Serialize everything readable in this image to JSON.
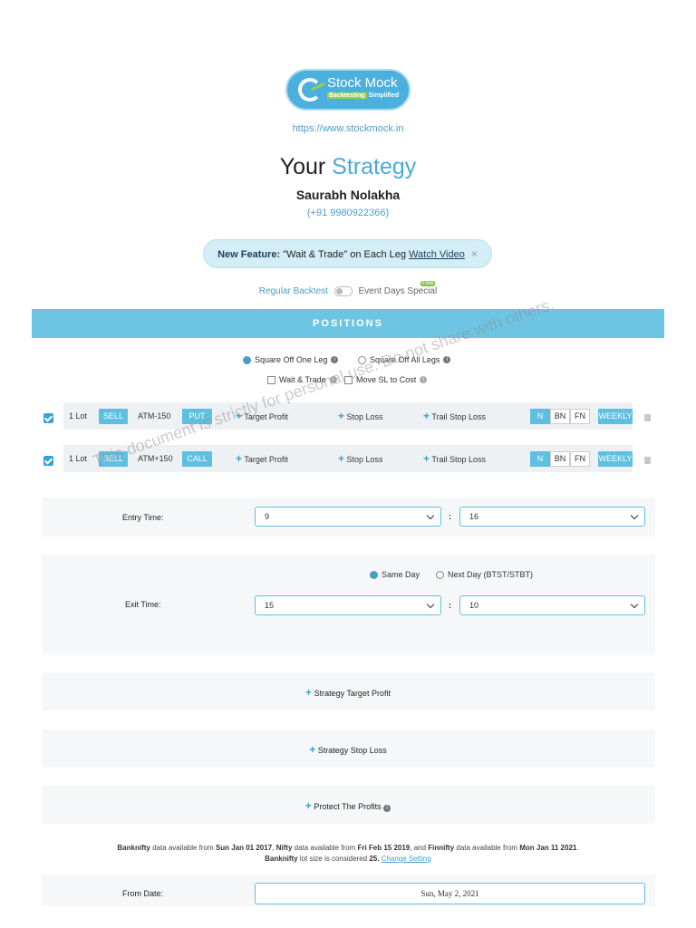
{
  "logo": {
    "name": "Stock Mock",
    "tagline_a": "Backtesting",
    "tagline_b": "Simplified"
  },
  "site_url": "https://www.stockmock.in",
  "title": {
    "part1": "Your",
    "part2": "Strategy"
  },
  "user": {
    "name": "Saurabh Nolakha",
    "phone": "(+91 9980922366)"
  },
  "banner": {
    "label": "New Feature:",
    "text": "\"Wait & Trade\" on Each Leg",
    "link": "Watch Video",
    "close": "×"
  },
  "mode": {
    "left": "Regular Backtest",
    "right": "Event Days Special",
    "badge": "Free"
  },
  "positions_title": "POSITIONS",
  "square_off": {
    "one_leg": "Square Off One Leg",
    "all_legs": "Square Off All Legs",
    "selected": "one_leg"
  },
  "options": {
    "wait_trade": "Wait & Trade",
    "move_sl": "Move SL to Cost"
  },
  "legs": [
    {
      "lots": "1 Lot",
      "side": "SELL",
      "strike": "ATM-150",
      "type": "PUT",
      "target": "Target Profit",
      "stop": "Stop Loss",
      "trail": "Trail Stop Loss",
      "indices": [
        "N",
        "BN",
        "FN"
      ],
      "selected_index": "BN",
      "expiry": "WEEKLY"
    },
    {
      "lots": "1 Lot",
      "side": "SELL",
      "strike": "ATM+150",
      "type": "CALL",
      "target": "Target Profit",
      "stop": "Stop Loss",
      "trail": "Trail Stop Loss",
      "indices": [
        "N",
        "BN",
        "FN"
      ],
      "selected_index": "BN",
      "expiry": "WEEKLY"
    }
  ],
  "entry": {
    "label": "Entry Time:",
    "hour": "9",
    "sep": ":",
    "minute": "16"
  },
  "exit": {
    "label": "Exit Time:",
    "same_day": "Same Day",
    "next_day": "Next Day (BTST/STBT)",
    "hour": "15",
    "sep": ":",
    "minute": "10"
  },
  "strategy_target": "Strategy Target Profit",
  "strategy_stop": "Strategy Stop Loss",
  "protect_profits": "Protect The Profits",
  "notice": {
    "bn": "Banknifty",
    "t1": " data available from ",
    "bn_date": "Sun Jan 01 2017",
    "t2": ", ",
    "nf": "Nifty",
    "t3": " data available from ",
    "nf_date": "Fri Feb 15 2019",
    "t4": ", and ",
    "fn": "Finnifty",
    "t5": " data available from ",
    "fn_date": "Mon Jan 11 2021",
    "t6": ".",
    "bn2": "Banknifty",
    "t7": " lot size is considered ",
    "lot": "25.",
    "link": "Change Setting"
  },
  "from_date": {
    "label": "From Date:",
    "value": "Sun, May 2, 2021"
  },
  "watermark": "This document is strictly for personal use. Do not share with others.",
  "colors": {
    "accent": "#6ec5e3",
    "link": "#4a9dc9",
    "title_highlight": "#4aa9d8"
  }
}
